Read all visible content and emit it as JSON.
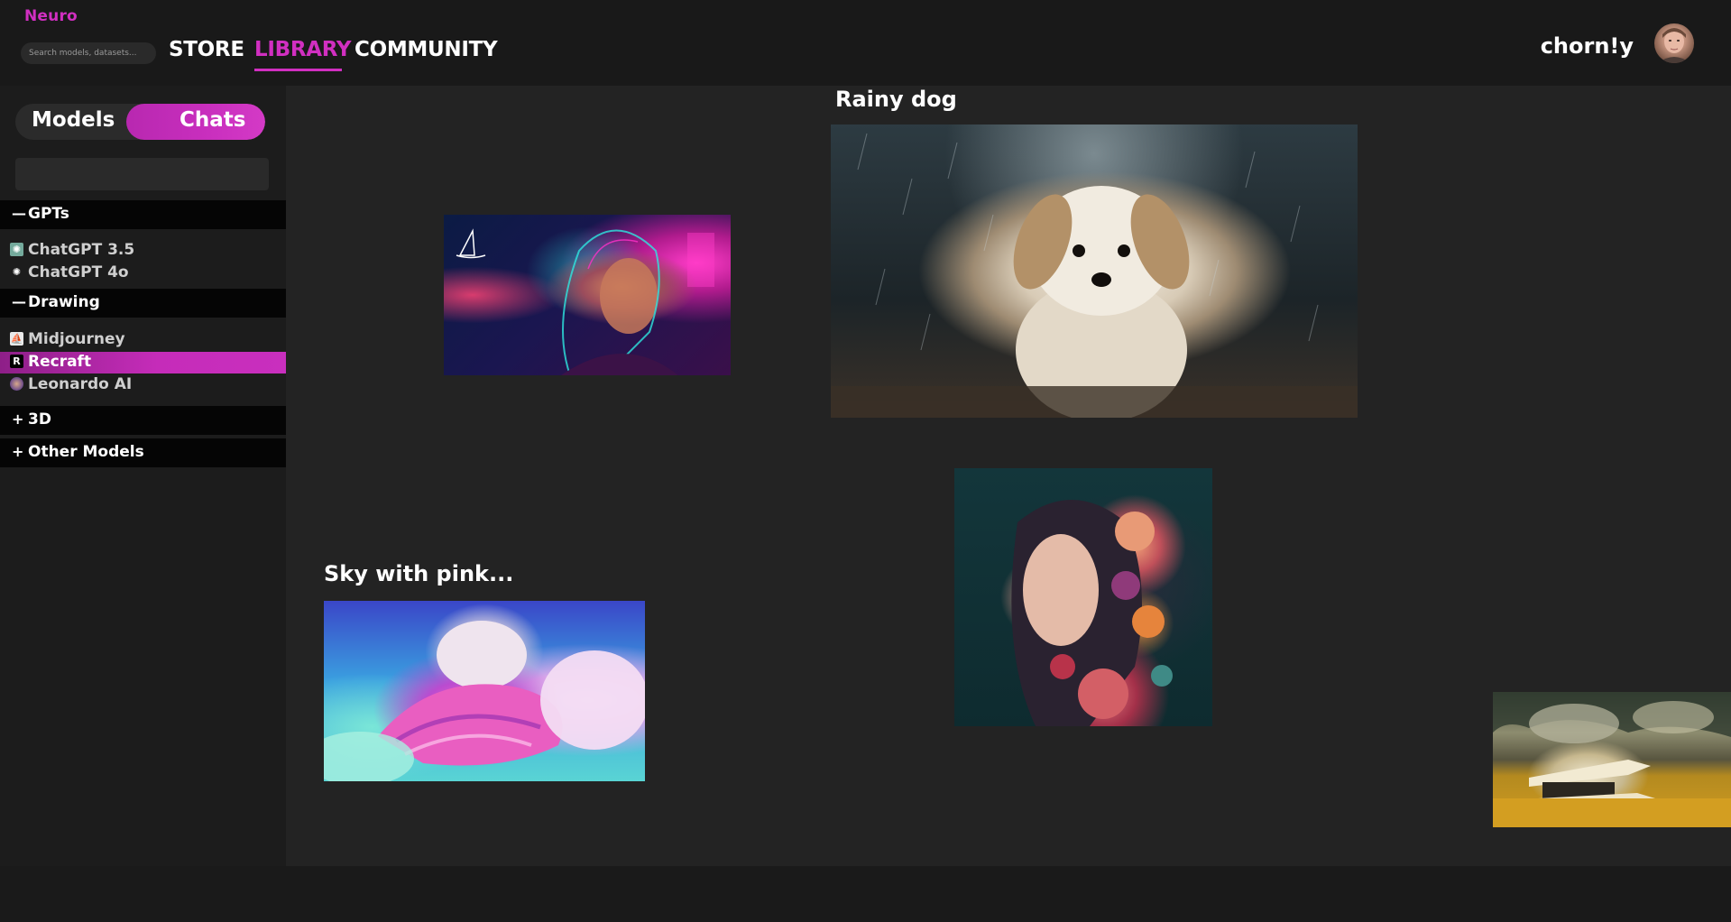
{
  "header": {
    "brand": "Neuro",
    "search_placeholder": "Search models, datasets...",
    "nav": [
      {
        "label": "STORE",
        "active": false
      },
      {
        "label": "LIBRARY",
        "active": true
      },
      {
        "label": "COMMUNITY",
        "active": false
      }
    ],
    "username": "chorn!y"
  },
  "sidebar": {
    "toggle": {
      "options": [
        "Models",
        "Chats"
      ],
      "selected": "Chats"
    },
    "groups": [
      {
        "sign": "—",
        "title": "GPTs",
        "expanded": true,
        "items": [
          {
            "label": "ChatGPT 3.5",
            "icon": "chatgpt-icon"
          },
          {
            "label": "ChatGPT 4o",
            "icon": "chatgpt-icon"
          }
        ]
      },
      {
        "sign": "—",
        "title": "Drawing",
        "expanded": true,
        "items": [
          {
            "label": "Midjourney",
            "icon": "midjourney-icon"
          },
          {
            "label": "Recraft",
            "icon": "recraft-icon",
            "selected": true
          },
          {
            "label": "Leonardo AI",
            "icon": "leonardo-icon"
          }
        ]
      },
      {
        "sign": "+",
        "title": "3D",
        "expanded": false,
        "items": []
      },
      {
        "sign": "+",
        "title": "Other Models",
        "expanded": false,
        "items": []
      }
    ]
  },
  "canvas": {
    "cards": [
      {
        "title": "",
        "image": "cyberpunk-woman-image"
      },
      {
        "title": "Rainy dog",
        "image": "rainy-dog-image"
      },
      {
        "title": "",
        "image": "flower-woman-image"
      },
      {
        "title": "Sky with pink...",
        "image": "pink-sky-clouds-image"
      },
      {
        "title": "",
        "image": "futuristic-house-image"
      }
    ]
  },
  "colors": {
    "accent": "#d12fc1",
    "background": "#232323",
    "sidebar": "#1c1c1c",
    "group_header": "#050505"
  }
}
